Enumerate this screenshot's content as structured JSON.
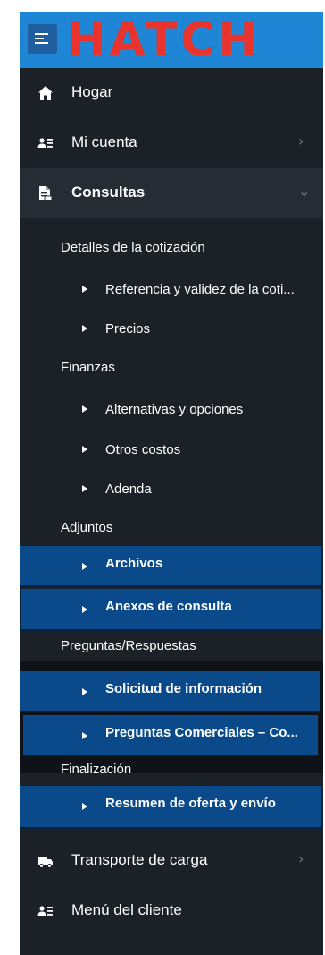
{
  "header": {
    "logo_text": "HATCH",
    "menu_icon": "hamburger-icon"
  },
  "nav": {
    "home": {
      "label": "Hogar",
      "icon": "home-icon"
    },
    "account": {
      "label": "Mi cuenta",
      "icon": "user-card-icon",
      "chevron": "›"
    },
    "consultas": {
      "label": "Consultas",
      "icon": "document-icon",
      "chevron": "⌄"
    },
    "transport": {
      "label": "Transporte de carga",
      "icon": "truck-icon",
      "chevron": "›"
    },
    "client_menu": {
      "label": "Menú del cliente",
      "icon": "user-card-icon"
    }
  },
  "consultas": {
    "quote_details": {
      "title": "Detalles de la cotización",
      "items": [
        "Referencia y validez de la coti...",
        "Precios"
      ]
    },
    "finance": {
      "title": "Finanzas",
      "items": [
        "Alternativas y opciones",
        "Otros costos",
        "Adenda"
      ]
    },
    "attachments": {
      "title": "Adjuntos",
      "items": [
        "Archivos",
        "Anexos de consulta"
      ]
    },
    "qa": {
      "title": "Preguntas/Respuestas",
      "items": [
        "Solicitud de información",
        "Preguntas Comerciales – Co..."
      ]
    },
    "finalization": {
      "title": "Finalización",
      "items": [
        "Resumen de oferta y envío"
      ]
    }
  },
  "colors": {
    "header_bg": "#1f86d6",
    "logo": "#e8342c",
    "sidebar_bg": "#1c2127",
    "highlight": "#0a4a8a"
  }
}
